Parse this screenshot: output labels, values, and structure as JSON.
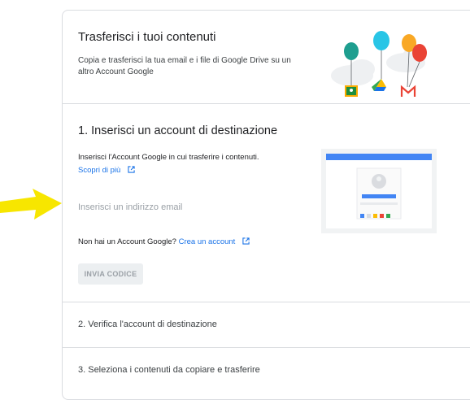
{
  "header": {
    "title": "Trasferisci i tuoi contenuti",
    "description": "Copia e trasferisci la tua email e i file di Google Drive su un altro Account Google"
  },
  "step1": {
    "title": "1. Inserisci un account di destinazione",
    "description": "Inserisci l'Account Google in cui trasferire i contenuti.",
    "learn_more": "Scopri di più",
    "email_placeholder": "Inserisci un indirizzo email",
    "no_account_text": "Non hai un Account Google?",
    "create_account": "Crea un account",
    "send_code_button": "INVIA CODICE"
  },
  "step2": {
    "title": "2. Verifica l'account di destinazione"
  },
  "step3": {
    "title": "3. Seleziona i contenuti da copiare e trasferire"
  },
  "colors": {
    "accent_blue": "#1a73e8",
    "highlight_yellow": "#f7e600",
    "balloon_teal": "#1e9e8f",
    "balloon_cyan": "#29c5e6",
    "balloon_orange": "#f9a825",
    "balloon_red": "#ea4335"
  }
}
